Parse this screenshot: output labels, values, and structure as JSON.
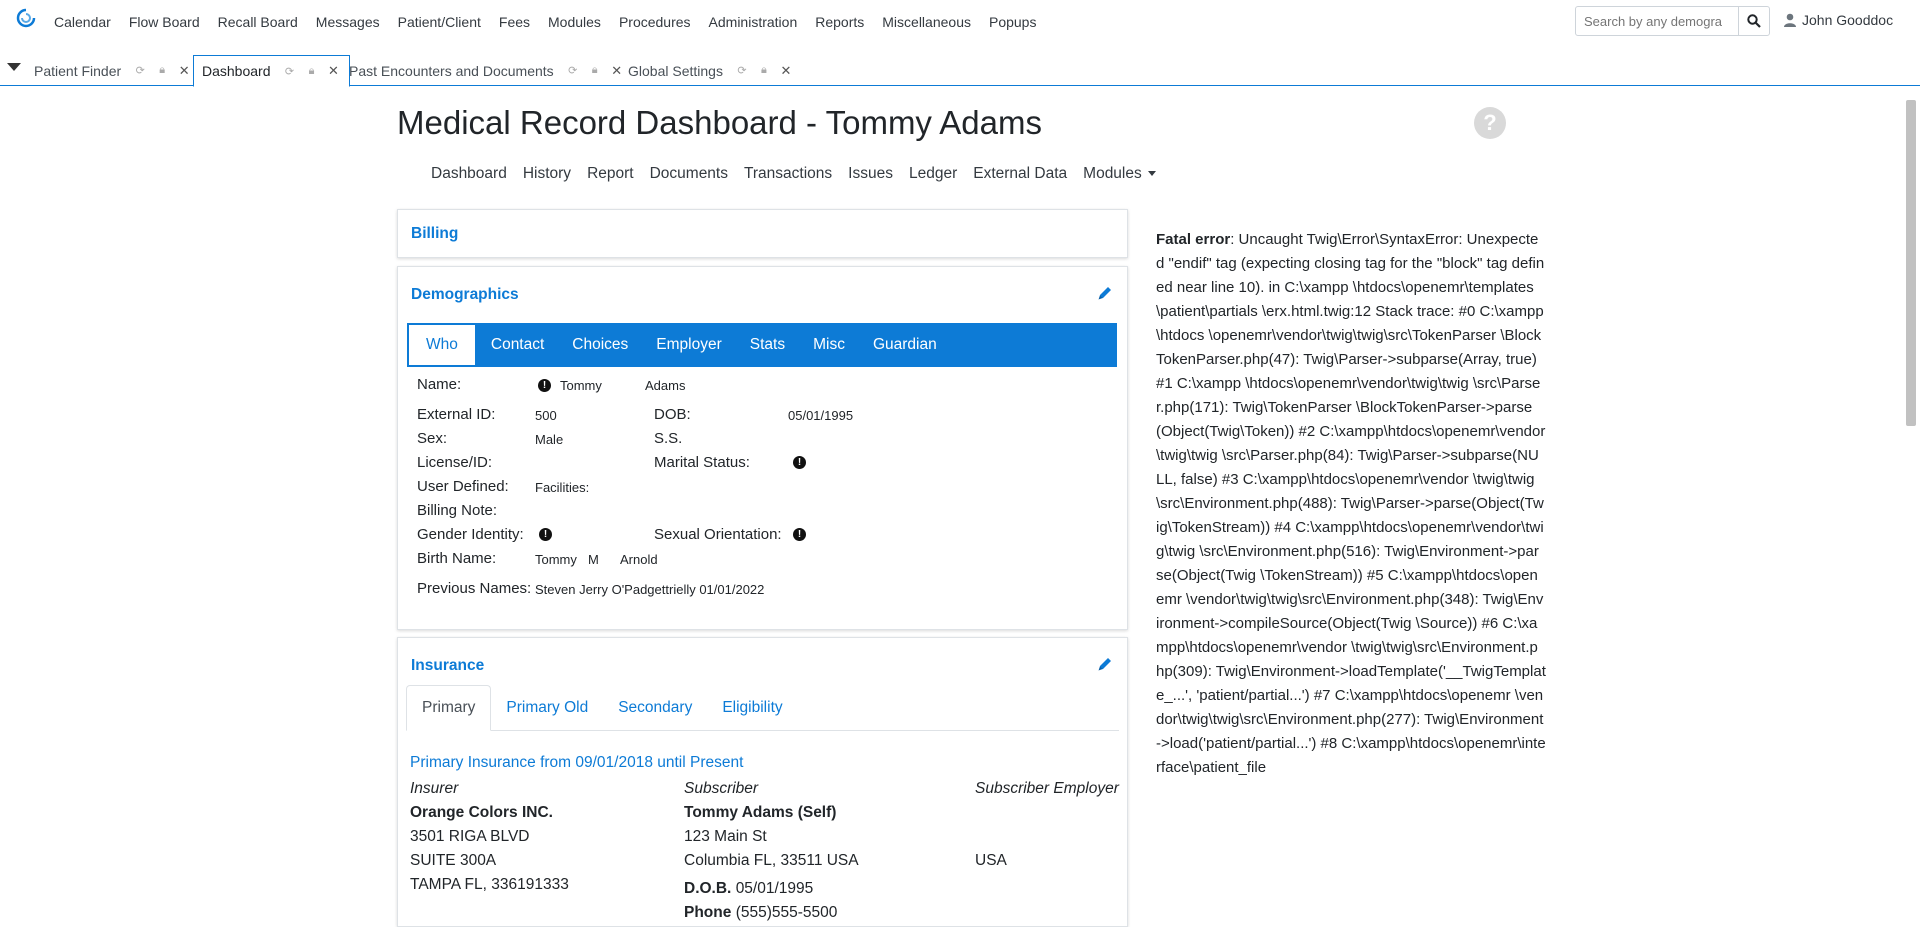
{
  "nav": {
    "menu": [
      "Calendar",
      "Flow Board",
      "Recall Board",
      "Messages",
      "Patient/Client",
      "Fees",
      "Modules",
      "Procedures",
      "Administration",
      "Reports",
      "Miscellaneous",
      "Popups"
    ],
    "search_placeholder": "Search by any demogra",
    "user": "John Gooddoc"
  },
  "tabs": [
    {
      "label": "Patient Finder"
    },
    {
      "label": "Dashboard"
    },
    {
      "label": "Past Encounters and Documents"
    },
    {
      "label": "Global Settings"
    }
  ],
  "page": {
    "title": "Medical Record Dashboard - Tommy Adams",
    "subnav": [
      "Dashboard",
      "History",
      "Report",
      "Documents",
      "Transactions",
      "Issues",
      "Ledger",
      "External Data",
      "Modules"
    ]
  },
  "billing": {
    "title": "Billing"
  },
  "demographics": {
    "title": "Demographics",
    "tabs": [
      "Who",
      "Contact",
      "Choices",
      "Employer",
      "Stats",
      "Misc",
      "Guardian"
    ],
    "labels": {
      "name": "Name:",
      "external_id": "External ID:",
      "dob": "DOB:",
      "sex": "Sex:",
      "ss": "S.S.",
      "license": "License/ID:",
      "marital": "Marital Status:",
      "user_defined": "User Defined:",
      "billing_note": "Billing Note:",
      "gender": "Gender Identity:",
      "sexual_orientation": "Sexual Orientation:",
      "birth_name": "Birth Name:",
      "previous_names": "Previous Names:"
    },
    "values": {
      "first_name": "Tommy",
      "last_name": "Adams",
      "external_id": "500",
      "dob": "05/01/1995",
      "sex": "Male",
      "facilities": "Facilities:",
      "birth_first": "Tommy",
      "birth_middle": "M",
      "birth_last": "Arnold",
      "previous_names": "Steven Jerry O'Padgettrielly 01/01/2022"
    }
  },
  "insurance": {
    "title": "Insurance",
    "tabs": [
      "Primary",
      "Primary Old",
      "Secondary",
      "Eligibility"
    ],
    "period": "Primary Insurance from 09/01/2018 until Present",
    "insurer": {
      "heading": "Insurer",
      "name": "Orange Colors INC.",
      "line1": "3501 RIGA BLVD",
      "line2": "SUITE 300A",
      "line3": "TAMPA FL, 336191333"
    },
    "subscriber": {
      "heading": "Subscriber",
      "name": "Tommy Adams (Self)",
      "line1": "123 Main St",
      "line2": "Columbia FL, 33511 USA",
      "dob_label": "D.O.B.",
      "dob": "05/01/1995",
      "phone_label": "Phone",
      "phone": "(555)555-5500"
    },
    "employer": {
      "heading": "Subscriber Employer",
      "country": "USA"
    }
  },
  "error": {
    "label": "Fatal error",
    "message": ": Uncaught Twig\\Error\\SyntaxError: Unexpected \"endif\" tag (expecting closing tag for the \"block\" tag defined near line 10). in C:\\xampp \\htdocs\\openemr\\templates\\patient\\partials \\erx.html.twig:12 Stack trace: #0 C:\\xampp\\htdocs \\openemr\\vendor\\twig\\twig\\src\\TokenParser \\BlockTokenParser.php(47): Twig\\Parser->subparse(Array, true) #1 C:\\xampp \\htdocs\\openemr\\vendor\\twig\\twig \\src\\Parser.php(171): Twig\\TokenParser \\BlockTokenParser->parse(Object(Twig\\Token)) #2 C:\\xampp\\htdocs\\openemr\\vendor\\twig\\twig \\src\\Parser.php(84): Twig\\Parser->subparse(NULL, false) #3 C:\\xampp\\htdocs\\openemr\\vendor \\twig\\twig\\src\\Environment.php(488): Twig\\Parser->parse(Object(Twig\\TokenStream)) #4 C:\\xampp\\htdocs\\openemr\\vendor\\twig\\twig \\src\\Environment.php(516): Twig\\Environment->parse(Object(Twig \\TokenStream)) #5 C:\\xampp\\htdocs\\openemr \\vendor\\twig\\twig\\src\\Environment.php(348): Twig\\Environment->compileSource(Object(Twig \\Source)) #6 C:\\xampp\\htdocs\\openemr\\vendor \\twig\\twig\\src\\Environment.php(309): Twig\\Environment->loadTemplate('__TwigTemplate_...', 'patient/partial...') #7 C:\\xampp\\htdocs\\openemr \\vendor\\twig\\twig\\src\\Environment.php(277): Twig\\Environment->load('patient/partial...') #8 C:\\xampp\\htdocs\\openemr\\interface\\patient_file"
  },
  "colors": {
    "accent": "#0d7bd6",
    "text": "#212529"
  }
}
